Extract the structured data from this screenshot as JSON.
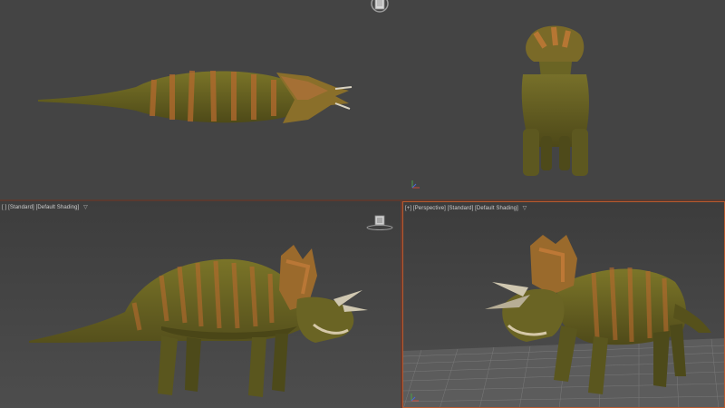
{
  "viewports": {
    "left": {
      "label_parts": [
        "[ ]",
        "[Standard]",
        "[Default Shading]"
      ]
    },
    "perspective": {
      "label_parts": [
        "[+]",
        "[Perspective]",
        "[Standard]",
        "[Default Shading]"
      ]
    }
  },
  "colors": {
    "active_viewport_border": "#b85a2e",
    "viewport_bg": "#444444",
    "dino_base": "#6b6a22",
    "dino_stripe": "#b56a2e",
    "grid": "#7a7a7a"
  },
  "icons": {
    "viewcube": "viewcube-icon",
    "filter": "funnel-icon",
    "axis": "axis-tripod-icon"
  }
}
